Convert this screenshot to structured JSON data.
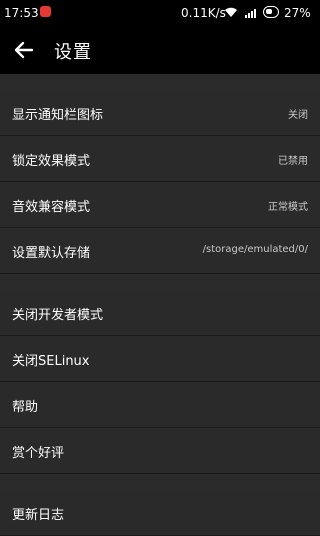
{
  "status_bar": {
    "time": "17:53",
    "network_speed": "0.11K/s",
    "battery_percent": "27%"
  },
  "app_bar": {
    "title": "设置"
  },
  "settings": {
    "group1": [
      {
        "label": "显示通知栏图标",
        "value": "关闭"
      },
      {
        "label": "锁定效果模式",
        "value": "已禁用"
      },
      {
        "label": "音效兼容模式",
        "value": "正常模式"
      },
      {
        "label": "设置默认存储",
        "value": "/storage/emulated/0/"
      }
    ],
    "group2": [
      {
        "label": "关闭开发者模式"
      },
      {
        "label": "关闭SELinux"
      },
      {
        "label": "帮助"
      },
      {
        "label": "赏个好评"
      }
    ],
    "group3": [
      {
        "label": "更新日志"
      }
    ]
  }
}
